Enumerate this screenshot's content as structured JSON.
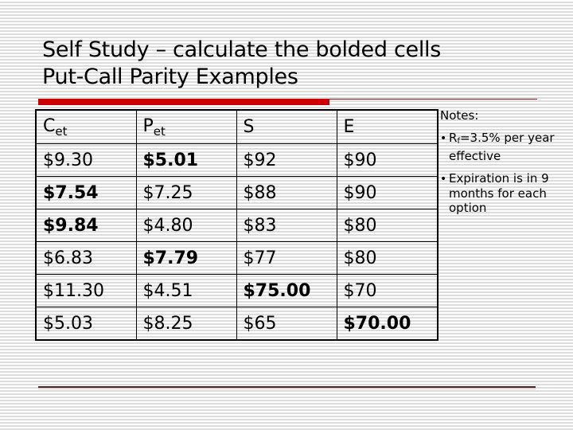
{
  "slide": {
    "title_line1": "Self Study – calculate the bolded cells",
    "title_line2": "Put-Call Parity Examples",
    "accent_color": "#cc0000"
  },
  "table": {
    "headers": [
      {
        "main": "C",
        "sub": "et"
      },
      {
        "main": "P",
        "sub": "et"
      },
      {
        "main": "S",
        "sub": ""
      },
      {
        "main": "E",
        "sub": ""
      }
    ],
    "rows": [
      [
        {
          "value": "$9.30",
          "bold": false
        },
        {
          "value": "$5.01",
          "bold": true
        },
        {
          "value": "$92",
          "bold": false
        },
        {
          "value": "$90",
          "bold": false
        }
      ],
      [
        {
          "value": "$7.54",
          "bold": true
        },
        {
          "value": "$7.25",
          "bold": false
        },
        {
          "value": "$88",
          "bold": false
        },
        {
          "value": "$90",
          "bold": false
        }
      ],
      [
        {
          "value": "$9.84",
          "bold": true
        },
        {
          "value": "$4.80",
          "bold": false
        },
        {
          "value": "$83",
          "bold": false
        },
        {
          "value": "$80",
          "bold": false
        }
      ],
      [
        {
          "value": "$6.83",
          "bold": false
        },
        {
          "value": "$7.79",
          "bold": true
        },
        {
          "value": "$77",
          "bold": false
        },
        {
          "value": "$80",
          "bold": false
        }
      ],
      [
        {
          "value": "$11.30",
          "bold": false
        },
        {
          "value": "$4.51",
          "bold": false
        },
        {
          "value": "$75.00",
          "bold": true
        },
        {
          "value": "$70",
          "bold": false
        }
      ],
      [
        {
          "value": "$5.03",
          "bold": false
        },
        {
          "value": "$8.25",
          "bold": false
        },
        {
          "value": "$65",
          "bold": false
        },
        {
          "value": "$70.00",
          "bold": true
        }
      ]
    ]
  },
  "notes": {
    "heading": "Notes:",
    "items": [
      {
        "bullet": "•",
        "prefix": "R",
        "sub": "f",
        "text": "=3.5% per year effective"
      },
      {
        "bullet": "•",
        "prefix": "",
        "sub": "",
        "text": "Expiration is in 9 months for each option"
      }
    ]
  }
}
